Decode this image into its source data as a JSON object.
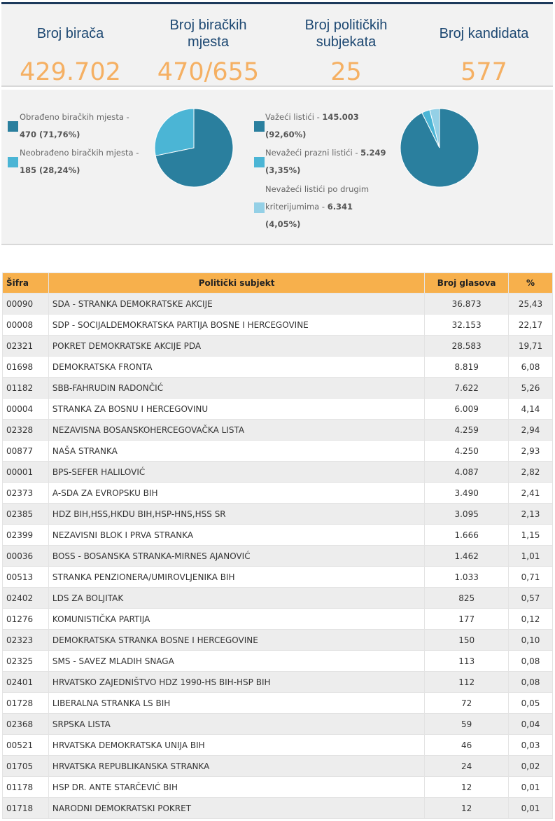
{
  "stats": [
    {
      "label": "Broj birača",
      "value": "429.702"
    },
    {
      "label": "Broj biračkih mjesta",
      "value": "470/655"
    },
    {
      "label": "Broj političkih subjekata",
      "value": "25"
    },
    {
      "label": "Broj kandidata",
      "value": "577"
    }
  ],
  "stations_chart": {
    "legend": [
      {
        "label": "Obrađeno biračkih mjesta -",
        "value": "470 (71,76%)",
        "color": "#2a7f9e"
      },
      {
        "label": "Neobrađeno biračkih mjesta -",
        "value": "185 (28,24%)",
        "color": "#4bb5d5"
      }
    ],
    "slices": [
      71.76,
      28.24
    ]
  },
  "ballots_chart": {
    "legend": [
      {
        "label": "Važeći listići -",
        "value": "145.003",
        "pct": "(92,60%)",
        "color": "#2a7f9e"
      },
      {
        "label": "Nevažeći prazni listići -",
        "value": "5.249",
        "pct": "(3,35%)",
        "color": "#4bb5d5"
      },
      {
        "label": "Nevažeći listići po drugim",
        "label2": "kriterijumima -",
        "value": "6.341",
        "pct": "(4,05%)",
        "color": "#94d0e6"
      }
    ],
    "slices": [
      92.6,
      3.35,
      4.05
    ]
  },
  "table": {
    "headers": {
      "code": "Šifra",
      "party": "Politički subjekt",
      "votes": "Broj glasova",
      "pct": "%"
    },
    "rows": [
      {
        "code": "00090",
        "party": "SDA - STRANKA DEMOKRATSKE AKCIJE",
        "votes": "36.873",
        "pct": "25,43"
      },
      {
        "code": "00008",
        "party": "SDP - SOCIJALDEMOKRATSKA PARTIJA BOSNE I HERCEGOVINE",
        "votes": "32.153",
        "pct": "22,17"
      },
      {
        "code": "02321",
        "party": "POKRET DEMOKRATSKE AKCIJE PDA",
        "votes": "28.583",
        "pct": "19,71"
      },
      {
        "code": "01698",
        "party": "DEMOKRATSKA FRONTA",
        "votes": "8.819",
        "pct": "6,08"
      },
      {
        "code": "01182",
        "party": "SBB-FAHRUDIN RADONČIĆ",
        "votes": "7.622",
        "pct": "5,26"
      },
      {
        "code": "00004",
        "party": "STRANKA ZA BOSNU I HERCEGOVINU",
        "votes": "6.009",
        "pct": "4,14"
      },
      {
        "code": "02328",
        "party": "NEZAVISNA BOSANSKOHERCEGOVAČKA LISTA",
        "votes": "4.259",
        "pct": "2,94"
      },
      {
        "code": "00877",
        "party": "NAŠA STRANKA",
        "votes": "4.250",
        "pct": "2,93"
      },
      {
        "code": "00001",
        "party": "BPS-SEFER HALILOVIĆ",
        "votes": "4.087",
        "pct": "2,82"
      },
      {
        "code": "02373",
        "party": "A-SDA ZA EVROPSKU BIH",
        "votes": "3.490",
        "pct": "2,41"
      },
      {
        "code": "02385",
        "party": "HDZ BIH,HSS,HKDU BIH,HSP-HNS,HSS SR",
        "votes": "3.095",
        "pct": "2,13"
      },
      {
        "code": "02399",
        "party": "NEZAVISNI BLOK I PRVA STRANKA",
        "votes": "1.666",
        "pct": "1,15"
      },
      {
        "code": "00036",
        "party": "BOSS - BOSANSKA STRANKA-MIRNES AJANOVIĆ",
        "votes": "1.462",
        "pct": "1,01"
      },
      {
        "code": "00513",
        "party": "STRANKA PENZIONERA/UMIROVLJENIKA BIH",
        "votes": "1.033",
        "pct": "0,71"
      },
      {
        "code": "02402",
        "party": "LDS ZA BOLJITAK",
        "votes": "825",
        "pct": "0,57"
      },
      {
        "code": "01276",
        "party": "KOMUNISTIČKA PARTIJA",
        "votes": "177",
        "pct": "0,12"
      },
      {
        "code": "02323",
        "party": "DEMOKRATSKA STRANKA BOSNE I HERCEGOVINE",
        "votes": "150",
        "pct": "0,10"
      },
      {
        "code": "02325",
        "party": "SMS - SAVEZ MLADIH SNAGA",
        "votes": "113",
        "pct": "0,08"
      },
      {
        "code": "02401",
        "party": "HRVATSKO ZAJEDNIŠTVO HDZ 1990-HS BIH-HSP BIH",
        "votes": "112",
        "pct": "0,08"
      },
      {
        "code": "01728",
        "party": "LIBERALNA STRANKA LS BIH",
        "votes": "72",
        "pct": "0,05"
      },
      {
        "code": "02368",
        "party": "SRPSKA LISTA",
        "votes": "59",
        "pct": "0,04"
      },
      {
        "code": "00521",
        "party": "HRVATSKA DEMOKRATSKA UNIJA BIH",
        "votes": "46",
        "pct": "0,03"
      },
      {
        "code": "01705",
        "party": "HRVATSKA REPUBLIKANSKA STRANKA",
        "votes": "24",
        "pct": "0,02"
      },
      {
        "code": "01178",
        "party": "HSP DR. ANTE STARČEVIĆ BIH",
        "votes": "12",
        "pct": "0,01"
      },
      {
        "code": "01718",
        "party": "NARODNI DEMOKRATSKI POKRET",
        "votes": "12",
        "pct": "0,01"
      }
    ]
  }
}
